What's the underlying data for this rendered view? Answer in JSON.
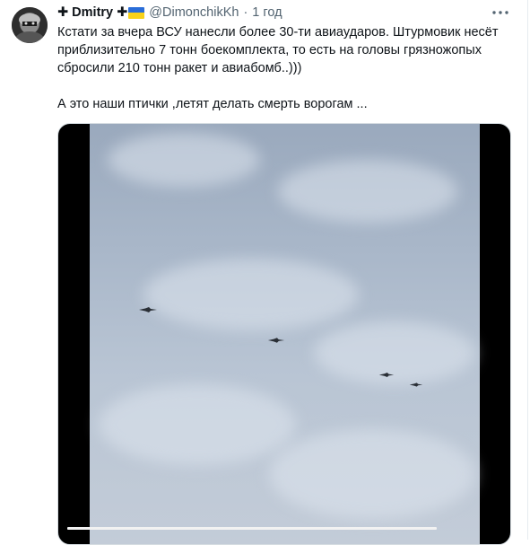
{
  "tweet": {
    "author_name": "✚ Dmitry ✚",
    "handle": "@DimonchikKh",
    "separator": "·",
    "time": "1 год",
    "text_lines": [
      "Кстати за вчера ВСУ нанесли более 30-ти авиаударов. Штурмовик несёт",
      "приблизительно 7 тонн боекомплекта, то есть на головы грязножопых",
      "сбросили 210 тонн ракет и авиабомб..)))"
    ],
    "text_line_last": "А это наши птички ,летят делать смерть ворогам ..."
  },
  "media": {
    "type": "video",
    "progress": 0.82
  },
  "icons": {
    "more": "more-options-icon",
    "flag": "ukraine-flag-icon"
  },
  "colors": {
    "text": "#0f1419",
    "secondary": "#536471",
    "flag_blue": "#2a6dd8",
    "flag_yellow": "#f8d21a"
  }
}
